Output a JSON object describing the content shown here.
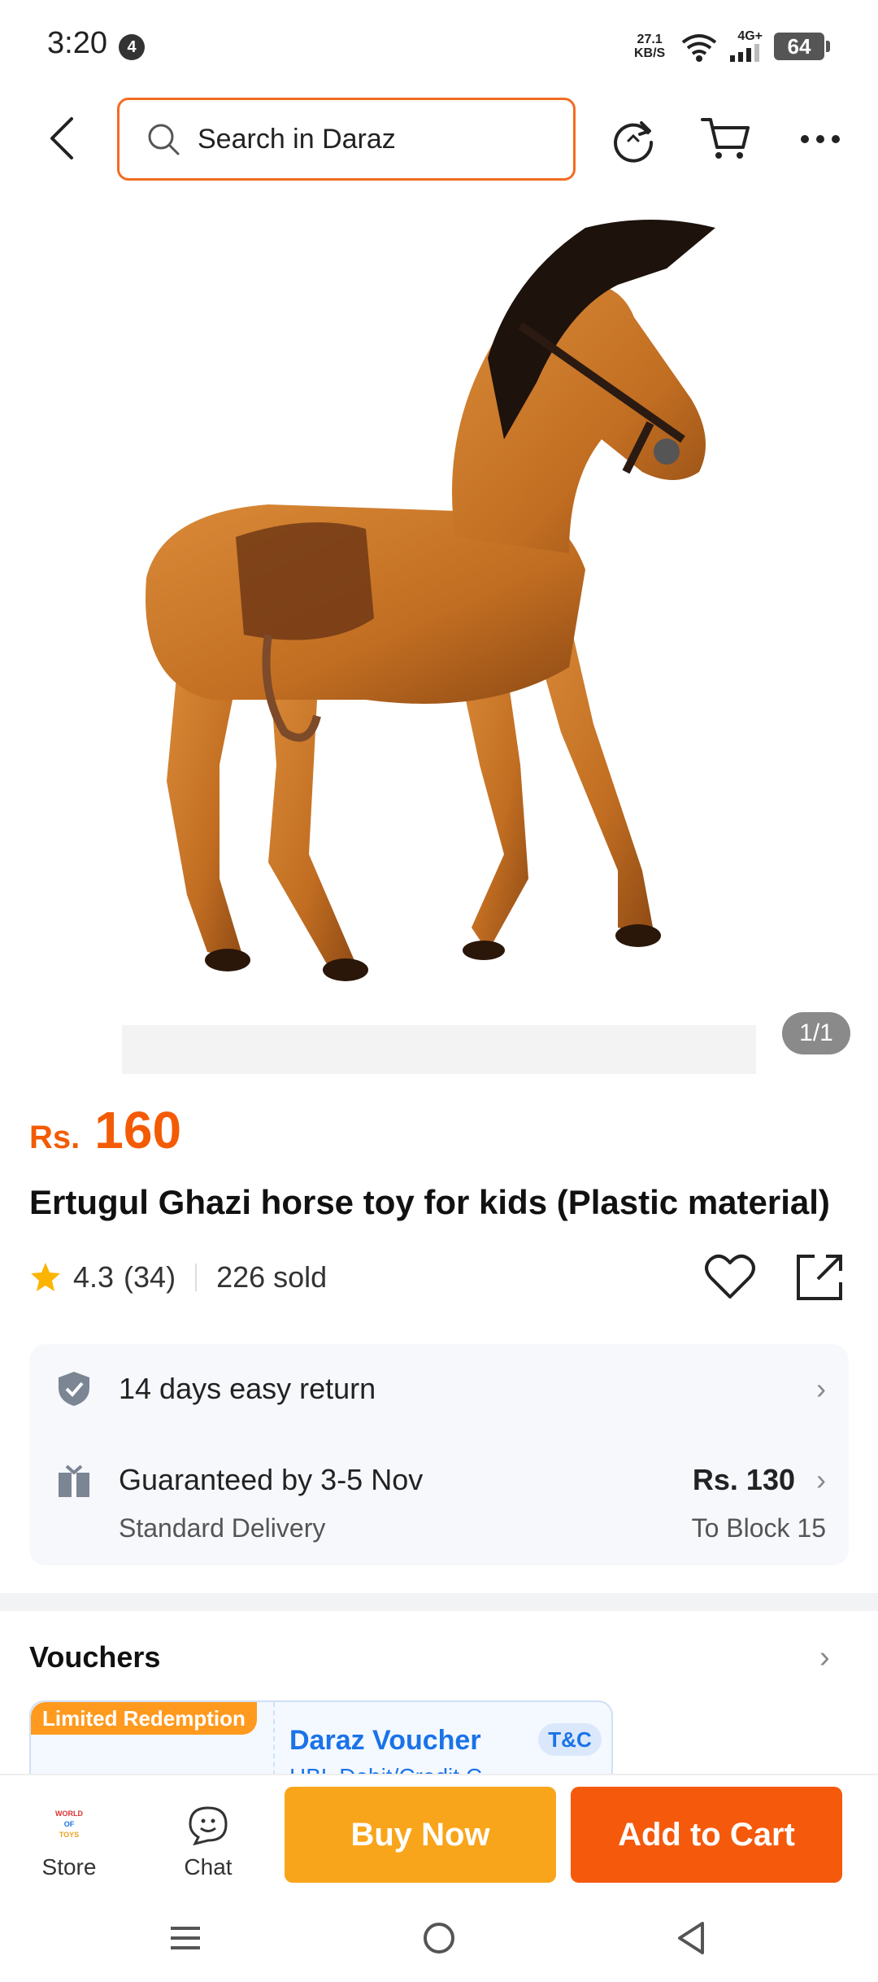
{
  "status_bar": {
    "time": "3:20",
    "notification_count": "4",
    "net_speed_value": "27.1",
    "net_speed_unit": "KB/S",
    "network_type": "4G+",
    "battery": "64"
  },
  "header": {
    "search_placeholder": "Search in Daraz",
    "icons": [
      "back-arrow-icon",
      "search-icon",
      "refresh-icon",
      "cart-icon",
      "more-icon"
    ]
  },
  "product": {
    "image_counter": "1/1",
    "price_currency": "Rs.",
    "price_value": "160",
    "title": "Ertugul Ghazi horse toy for kids (Plastic material)",
    "rating": "4.3",
    "reviews": "(34)",
    "sold": "226 sold"
  },
  "services": {
    "return_text": "14 days easy return",
    "delivery_text": "Guaranteed by 3-5 Nov",
    "delivery_type": "Standard Delivery",
    "delivery_fee": "Rs. 130",
    "delivery_location": "To Block 15"
  },
  "vouchers": {
    "title": "Vouchers",
    "tag": "Limited Redemption",
    "name": "Daraz Voucher",
    "tc": "T&C",
    "subtitle": "HBL Debit/Credit C..."
  },
  "action_bar": {
    "store_label": "Store",
    "store_logo_text": "WORLD OF TOYS",
    "chat_label": "Chat",
    "buy_now": "Buy Now",
    "add_to_cart": "Add to Cart"
  },
  "colors": {
    "accent_orange": "#f36c21",
    "price": "#f35b04",
    "buy_now": "#f9a51b",
    "add_to_cart": "#f55a0c",
    "voucher_blue": "#1a73e8"
  }
}
